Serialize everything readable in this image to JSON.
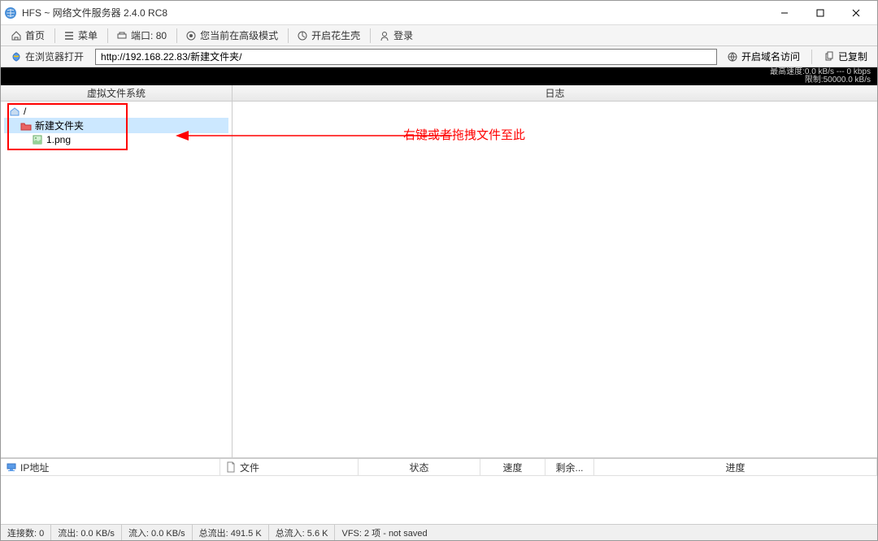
{
  "window": {
    "title": "HFS ~ 网络文件服务器 2.4.0 RC8"
  },
  "toolbar1": {
    "home": "首页",
    "menu": "菜单",
    "port_label": "端口: 80",
    "mode": "您当前在高级模式",
    "peanut": "开启花生壳",
    "login": "登录"
  },
  "toolbar2": {
    "open_browser": "在浏览器打开",
    "url": "http://192.168.22.83/新建文件夹/",
    "domain_access": "开启域名访问",
    "copied": "已复制"
  },
  "speed": {
    "line1": "最高速度:0.0 kB/s --- 0 kbps",
    "line2": "限制:50000.0 kB/s"
  },
  "panels": {
    "vfs_header": "虚拟文件系统",
    "log_header": "日志"
  },
  "tree": {
    "root": "/",
    "folder": "新建文件夹",
    "file": "1.png"
  },
  "annotation": {
    "text": "右键或者拖拽文件至此"
  },
  "list_headers": {
    "ip": "IP地址",
    "file": "文件",
    "status": "状态",
    "speed": "速度",
    "remaining": "剩余...",
    "progress": "进度"
  },
  "statusbar": {
    "connections": "连接数: 0",
    "out": "流出: 0.0 KB/s",
    "in": "流入: 0.0 KB/s",
    "total_out": "总流出: 491.5 K",
    "total_in": "总流入: 5.6 K",
    "vfs": "VFS: 2 项 - not saved"
  }
}
